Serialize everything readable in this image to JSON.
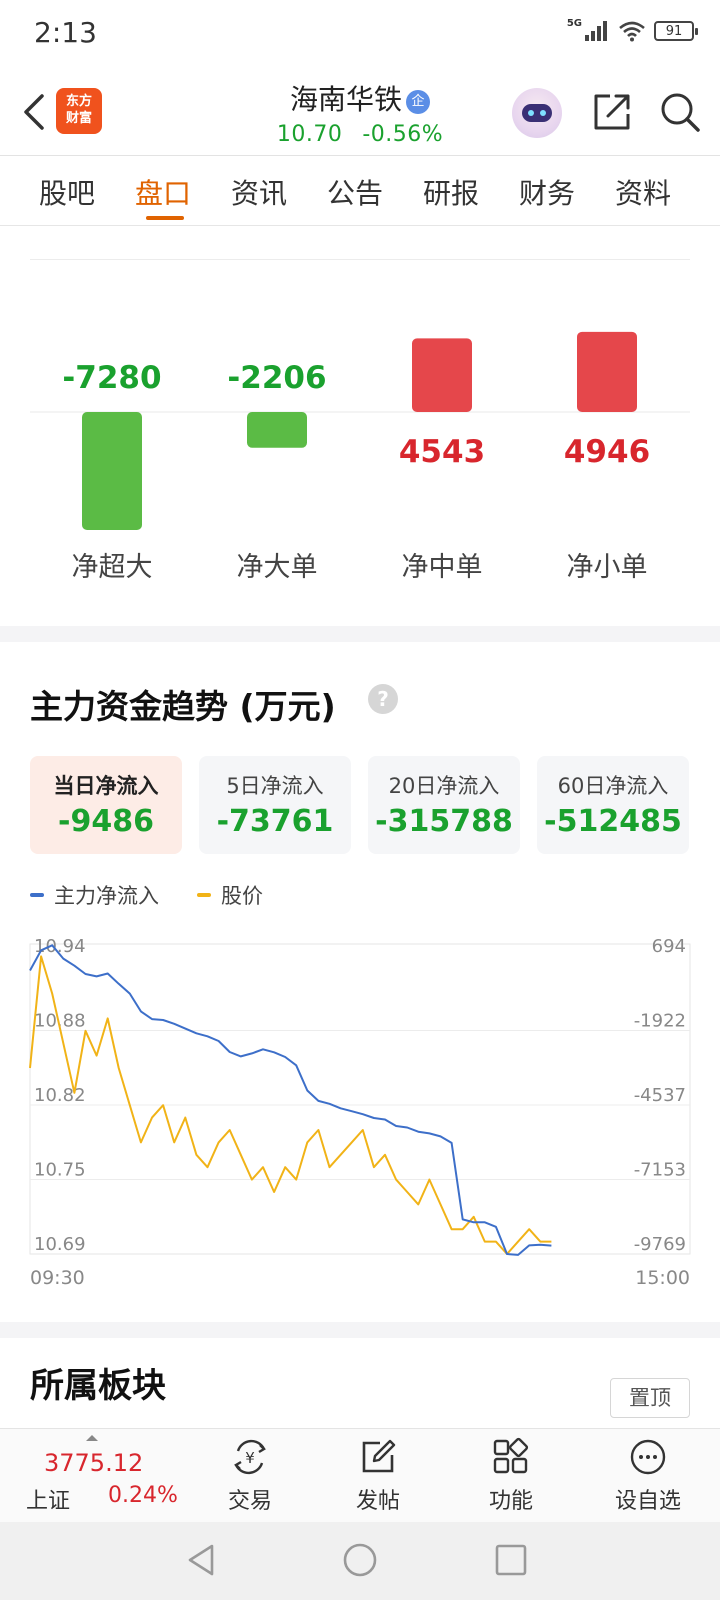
{
  "status_bar": {
    "time": "2:13",
    "network": "5G",
    "battery": "91"
  },
  "header": {
    "app_logo_text": "东方\n财富",
    "stock_name": "海南华铁",
    "corp_badge": "企",
    "price": "10.70",
    "change_pct": "-0.56%"
  },
  "tabs": [
    {
      "label": "股吧"
    },
    {
      "label": "盘口"
    },
    {
      "label": "资讯"
    },
    {
      "label": "公告"
    },
    {
      "label": "研报"
    },
    {
      "label": "财务"
    },
    {
      "label": "资料"
    }
  ],
  "active_tab": "盘口",
  "colors": {
    "up_red": "#e5474b",
    "down_green": "#5bbb45",
    "accent_orange": "#e06300",
    "line_blue": "#3d6fc9",
    "line_gold": "#f1b317"
  },
  "net_flow_bars": {
    "chart_data": {
      "type": "bar",
      "categories": [
        "净超大",
        "净大单",
        "净中单",
        "净小单"
      ],
      "values": [
        -7280,
        -2206,
        4543,
        4946
      ],
      "value_labels": [
        "-7280",
        "-2206",
        "4543",
        "4946"
      ]
    }
  },
  "trend": {
    "title": "主力资金趋势 (万元)",
    "help_icon": "?",
    "boxes": [
      {
        "label": "当日净流入",
        "value": "-9486"
      },
      {
        "label": "5日净流入",
        "value": "-73761"
      },
      {
        "label": "20日净流入",
        "value": "-315788"
      },
      {
        "label": "60日净流入",
        "value": "-512485"
      }
    ],
    "legend": [
      {
        "name": "主力净流入",
        "color": "#3d6fc9"
      },
      {
        "name": "股价",
        "color": "#f1b317"
      }
    ],
    "chart_data": {
      "type": "line",
      "x_start": "09:30",
      "x_end": "15:00",
      "left_axis_ticks": [
        "10.94",
        "10.88",
        "10.82",
        "10.75",
        "10.69"
      ],
      "left_axis_range": [
        10.69,
        10.94
      ],
      "right_axis_ticks": [
        "694",
        "-1922",
        "-4537",
        "-7153",
        "-9769"
      ],
      "right_axis_range": [
        -9769,
        694
      ],
      "series": [
        {
          "name": "主力净流入",
          "axis": "right",
          "values": [
            -200,
            480,
            650,
            200,
            -40,
            -320,
            -400,
            -300,
            -650,
            -980,
            -1580,
            -1840,
            -1870,
            -2000,
            -2160,
            -2320,
            -2420,
            -2580,
            -2950,
            -3100,
            -3000,
            -2860,
            -2960,
            -3120,
            -3400,
            -4250,
            -4600,
            -4700,
            -4850,
            -4950,
            -5050,
            -5180,
            -5230,
            -5450,
            -5500,
            -5640,
            -5700,
            -5800,
            -6020,
            -8600,
            -8700,
            -8700,
            -8850,
            -9770,
            -9800,
            -9480,
            -9460,
            -9486
          ]
        },
        {
          "name": "股价",
          "axis": "left",
          "values": [
            10.84,
            10.93,
            10.9,
            10.86,
            10.82,
            10.87,
            10.85,
            10.88,
            10.84,
            10.81,
            10.78,
            10.8,
            10.81,
            10.78,
            10.8,
            10.77,
            10.76,
            10.78,
            10.79,
            10.77,
            10.75,
            10.76,
            10.74,
            10.76,
            10.75,
            10.78,
            10.79,
            10.76,
            10.77,
            10.78,
            10.79,
            10.76,
            10.77,
            10.75,
            10.74,
            10.73,
            10.75,
            10.73,
            10.71,
            10.71,
            10.72,
            10.7,
            10.7,
            10.69,
            10.7,
            10.71,
            10.7,
            10.7
          ]
        }
      ]
    }
  },
  "board_section": {
    "title": "所属板块",
    "pin_button": "置顶"
  },
  "bottom_bar": {
    "index_value": "3775.12",
    "index_name": "上证",
    "index_change": "0.24%",
    "items": [
      {
        "label": "交易",
        "icon": "yen-exchange-icon"
      },
      {
        "label": "发帖",
        "icon": "edit-icon"
      },
      {
        "label": "功能",
        "icon": "grid-icon"
      },
      {
        "label": "设自选",
        "icon": "more-circle-icon"
      }
    ]
  }
}
